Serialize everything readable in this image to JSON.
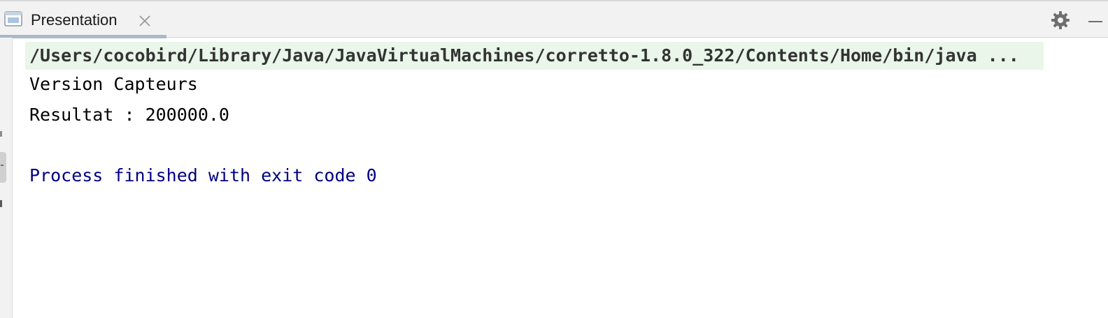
{
  "tab": {
    "label": "Presentation",
    "icon": "console-window-icon",
    "close_icon": "close-icon"
  },
  "toolbar": {
    "settings_icon": "gear-icon",
    "minimize_icon": "minimize-icon"
  },
  "console": {
    "command": "/Users/cocobird/Library/Java/JavaVirtualMachines/corretto-1.8.0_322/Contents/Home/bin/java ...",
    "output": [
      "Version Capteurs",
      "Resultat : 200000.0"
    ],
    "exit_message": "Process finished with exit code 0"
  },
  "colors": {
    "command_background": "#e9f6e9",
    "exit_text": "#000080",
    "tab_underline": "#a9b7c9"
  }
}
